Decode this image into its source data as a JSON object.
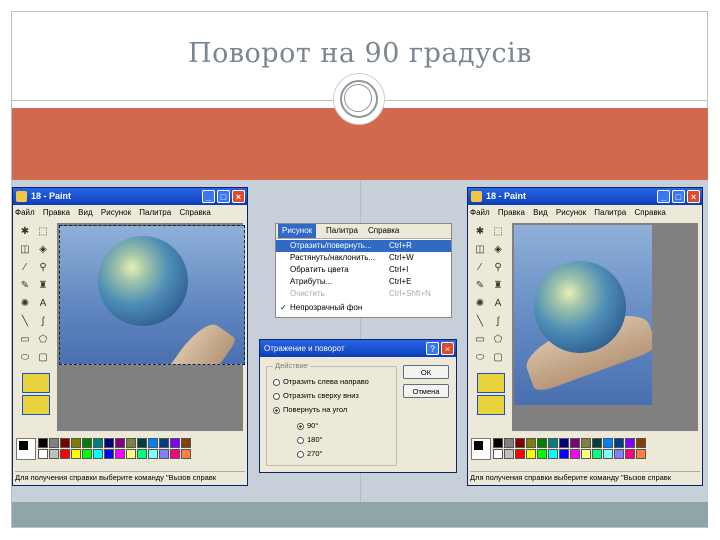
{
  "slide": {
    "title": "Поворот на 90 градусів"
  },
  "left_window": {
    "title": "18 - Paint",
    "menu": [
      "Файл",
      "Правка",
      "Вид",
      "Рисунок",
      "Палитра",
      "Справка"
    ],
    "status": "Для получения справки выберите команду \"Вызов справк"
  },
  "right_window": {
    "title": "18 - Paint",
    "menu": [
      "Файл",
      "Правка",
      "Вид",
      "Рисунок",
      "Палитра",
      "Справка"
    ],
    "status": "Для получения справки выберите команду \"Вызов справк"
  },
  "image_menu": {
    "bar": [
      "Рисунок",
      "Палитра",
      "Справка"
    ],
    "items": [
      {
        "label": "Отразить/повернуть...",
        "shortcut": "Ctrl+R"
      },
      {
        "label": "Растянуть/наклонить...",
        "shortcut": "Ctrl+W"
      },
      {
        "label": "Обратить цвета",
        "shortcut": "Ctrl+I"
      },
      {
        "label": "Атрибуты...",
        "shortcut": "Ctrl+E"
      },
      {
        "label": "Очистить",
        "shortcut": "Ctrl+Shft+N"
      },
      {
        "label": "Непрозрачный фон",
        "shortcut": ""
      }
    ]
  },
  "dialog": {
    "title": "Отражение и поворот",
    "group_label": "Действие",
    "options": [
      "Отразить слева направо",
      "Отразить сверху вниз",
      "Повернуть на угол"
    ],
    "angles": [
      "90°",
      "180°",
      "270°"
    ],
    "ok_label": "ОК",
    "cancel_label": "Отмена"
  },
  "palette_colors": [
    "#000000",
    "#808080",
    "#800000",
    "#808000",
    "#008000",
    "#008080",
    "#000080",
    "#800080",
    "#808040",
    "#004040",
    "#0080ff",
    "#004080",
    "#8000ff",
    "#804000",
    "#ffffff",
    "#c0c0c0",
    "#ff0000",
    "#ffff00",
    "#00ff00",
    "#00ffff",
    "#0000ff",
    "#ff00ff",
    "#ffff80",
    "#00ff80",
    "#80ffff",
    "#8080ff",
    "#ff0080",
    "#ff8040"
  ],
  "colors": {
    "band": "#d2694c",
    "content_bg": "#c7d0d8",
    "bottom_strip": "#8fa6a9",
    "title_text": "#7b8690",
    "xp_title": "#1f55d6",
    "menu_highlight": "#316ac5"
  },
  "icons": [
    "paint-app-icon",
    "minimize-icon",
    "maximize-icon",
    "close-icon",
    "help-icon",
    "checkmark-icon"
  ]
}
